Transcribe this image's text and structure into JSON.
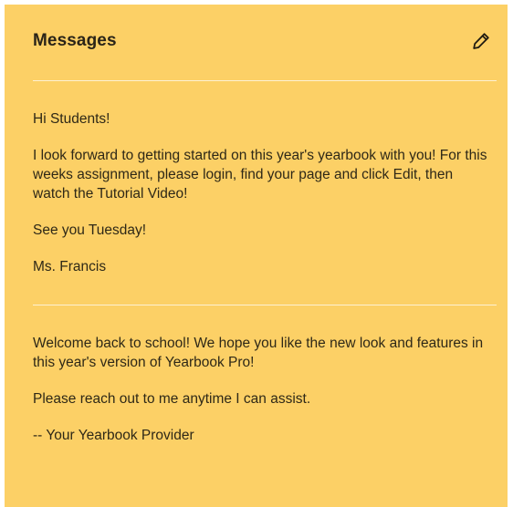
{
  "panel": {
    "title": "Messages",
    "edit_icon": "pencil-icon",
    "background": "#fcd066"
  },
  "messages": [
    {
      "paragraphs": [
        "Hi Students!",
        "I look forward to getting started on this year's yearbook with you! For this weeks assignment, please login, find your page and click Edit, then watch the Tutorial Video!",
        "See you Tuesday!",
        "Ms. Francis"
      ]
    },
    {
      "paragraphs": [
        "Welcome back to school! We hope you like the new look and features in this year's version of Yearbook Pro!",
        "Please reach out to me anytime I can assist.",
        "-- Your Yearbook Provider"
      ]
    }
  ]
}
